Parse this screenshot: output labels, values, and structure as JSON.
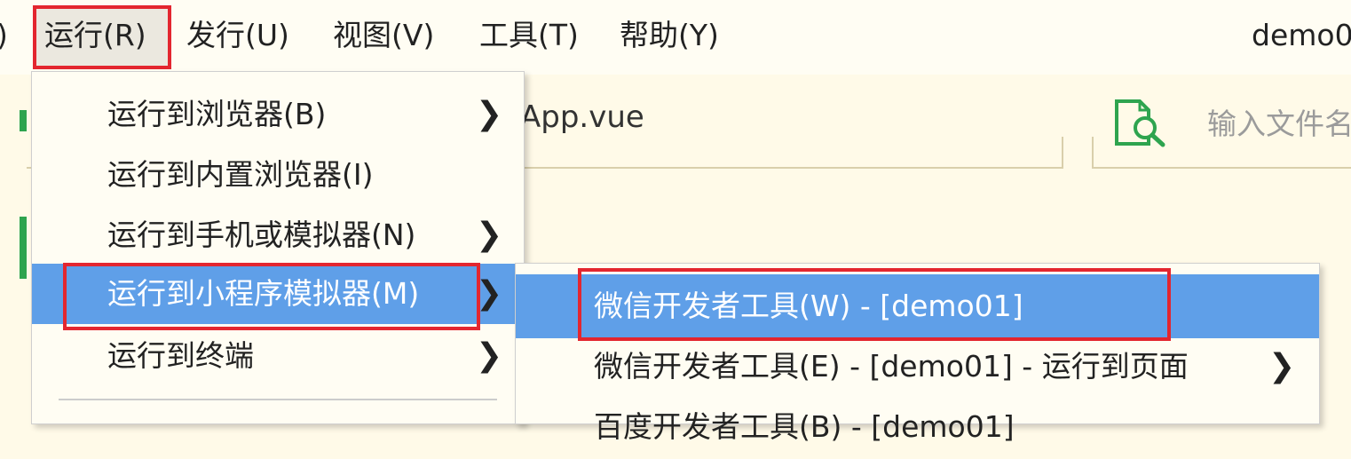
{
  "menubar": {
    "partial_left": ")",
    "items": [
      {
        "label": "运行(R)"
      },
      {
        "label": "发行(U)"
      },
      {
        "label": "视图(V)"
      },
      {
        "label": "工具(T)"
      },
      {
        "label": "帮助(Y)"
      }
    ],
    "project_name": "demo0"
  },
  "tab": {
    "label": "App.vue"
  },
  "file_search": {
    "placeholder": "输入文件名",
    "icon": "file-search-icon"
  },
  "run_menu": {
    "items": [
      {
        "label": "运行到浏览器(B)",
        "has_submenu": true
      },
      {
        "label": "运行到内置浏览器(I)",
        "has_submenu": false
      },
      {
        "label": "运行到手机或模拟器(N)",
        "has_submenu": true
      },
      {
        "label": "运行到小程序模拟器(M)",
        "has_submenu": true,
        "highlighted": true
      },
      {
        "label": "运行到终端",
        "has_submenu": true
      }
    ]
  },
  "miniprogram_submenu": {
    "items": [
      {
        "label": "微信开发者工具(W) - [demo01]",
        "highlighted": true
      },
      {
        "label": "微信开发者工具(E) - [demo01] - 运行到页面",
        "has_submenu": true
      },
      {
        "label": "百度开发者工具(B) - [demo01]"
      }
    ]
  },
  "colors": {
    "highlight": "#5f9fe8",
    "annotation": "#e3262f",
    "accent_green": "#2ea44f",
    "background": "#fffae8"
  }
}
